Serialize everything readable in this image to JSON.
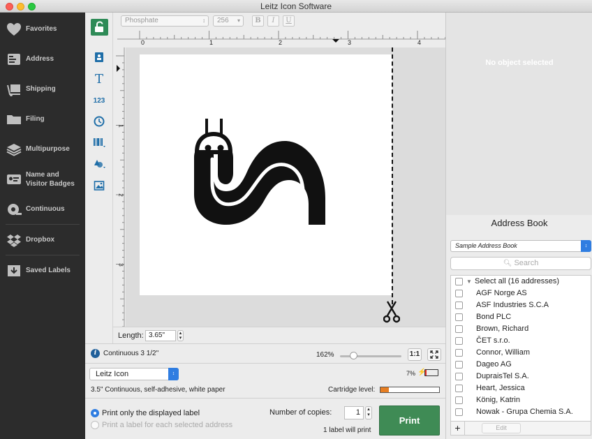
{
  "window": {
    "title": "Leitz Icon Software"
  },
  "sidebar": {
    "items": [
      {
        "label": "Favorites",
        "icon": "heart-icon"
      },
      {
        "label": "Address",
        "icon": "address-icon"
      },
      {
        "label": "Shipping",
        "icon": "shipping-icon"
      },
      {
        "label": "Filing",
        "icon": "folder-icon"
      },
      {
        "label": "Multipurpose",
        "icon": "layers-icon"
      },
      {
        "label": "Name and Visitor Badges",
        "icon": "badge-icon"
      },
      {
        "label": "Continuous",
        "icon": "roll-icon"
      },
      {
        "label": "Dropbox",
        "icon": "dropbox-icon"
      },
      {
        "label": "Saved Labels",
        "icon": "download-box-icon"
      }
    ]
  },
  "toolbar": {
    "font": "Phosphate",
    "size": "256",
    "bold": "B",
    "italic": "I",
    "underline": "U"
  },
  "tools": {
    "text": "T",
    "counter": "123"
  },
  "ruler": {
    "top_labels": [
      "0",
      "1",
      "2",
      "3",
      "4"
    ],
    "left_labels": [
      "1",
      "2",
      "3"
    ]
  },
  "canvas": {
    "length_label": "Length:",
    "length_value": "3.65\""
  },
  "info": {
    "info_symbol": "i",
    "media_name": "Continuous 3 1/2\"",
    "zoom": "162%",
    "zoom_level": 0.18,
    "one_to_one": "1:1"
  },
  "device": {
    "printer": "Leitz Icon",
    "battery": "7%"
  },
  "paper": {
    "description": "3.5\" Continuous, self-adhesive, white paper",
    "cartridge_label": "Cartridge level:",
    "cartridge_level": 0.14
  },
  "print": {
    "option_displayed": "Print only the displayed label",
    "option_each": "Print a label for each selected address",
    "copies_label": "Number of copies:",
    "copies": "1",
    "will_print": "1 label will print",
    "print_button": "Print"
  },
  "properties": {
    "empty_text": "No object selected"
  },
  "address_book": {
    "title": "Address Book",
    "source": "Sample Address Book",
    "search_placeholder": "Search",
    "select_all": "Select all (16 addresses)",
    "entries": [
      "AGF Norge AS",
      "ASF Industries S.C.A",
      "Bond PLC",
      "Brown, Richard",
      "ČET s.r.o.",
      "Connor, William",
      "Dageo AG",
      "DupraisTel S.A.",
      "Heart, Jessica",
      "König, Katrin",
      "Nowak - Grupa Chemia S.A."
    ],
    "add": "+",
    "edit": "Edit"
  },
  "colors": {
    "sidebar_bg": "#2c2c2c",
    "accent_green": "#3f8b55",
    "tool_blue": "#1f6ea8",
    "select_blue": "#2f7de1",
    "cartridge_orange": "#e67e22"
  }
}
